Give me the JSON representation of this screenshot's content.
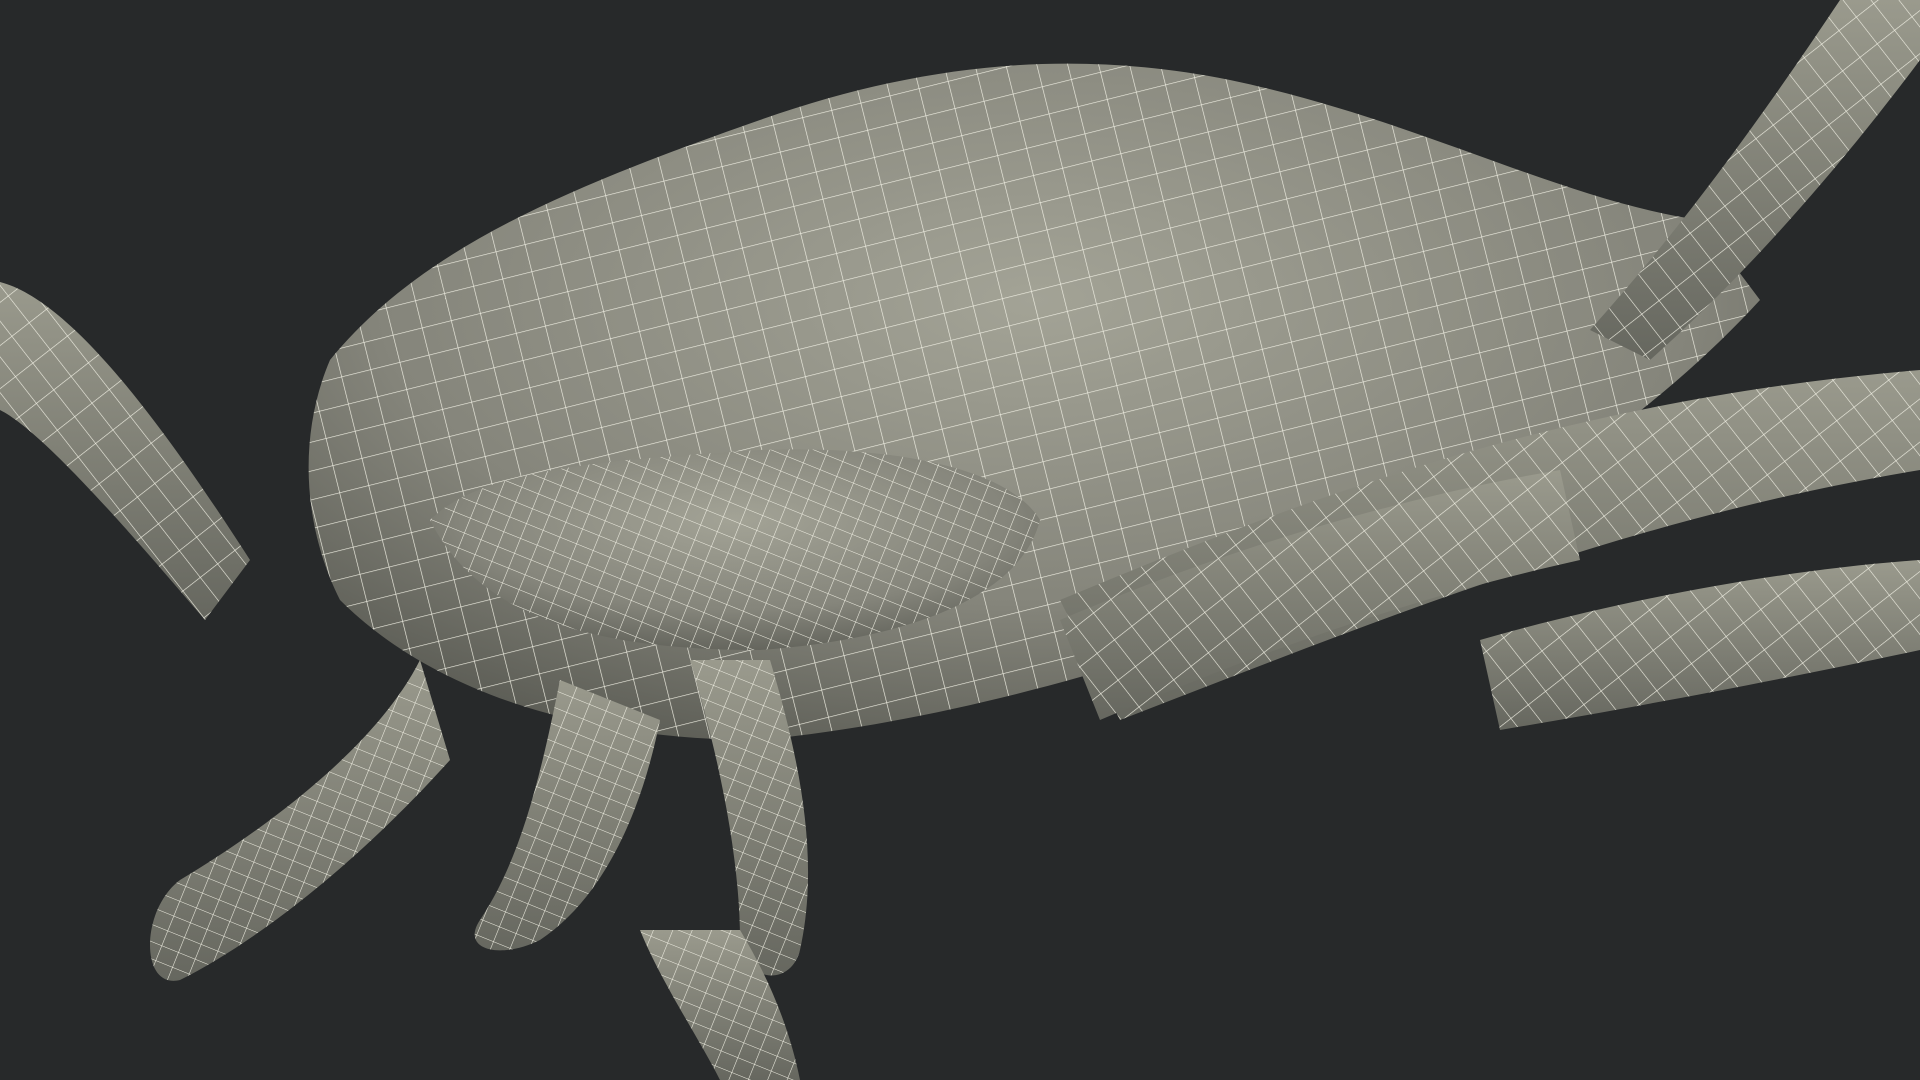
{
  "scene": {
    "background_color": "#27292a",
    "mesh_fill_color": "#85857b",
    "mesh_shade_color": "#55564f",
    "mesh_highlight_color": "#a3a396",
    "wire_color": "#efeee2",
    "subject": "wireframe-render"
  }
}
